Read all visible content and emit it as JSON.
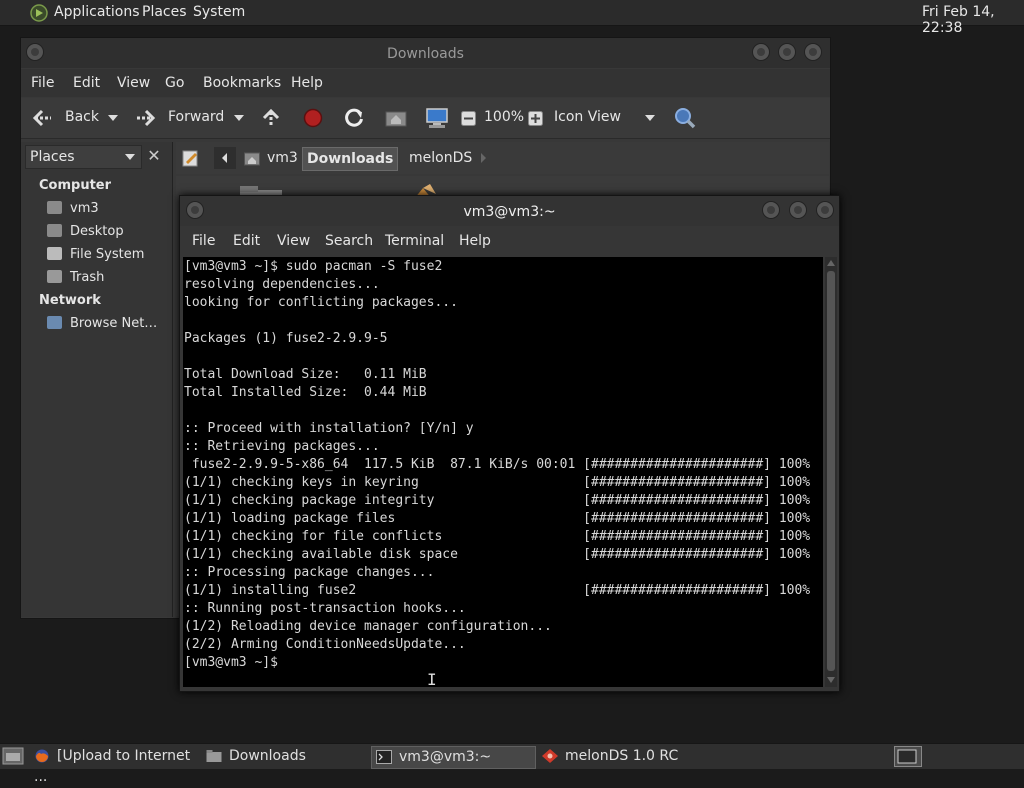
{
  "top_panel": {
    "menus": [
      "Applications",
      "Places",
      "System"
    ],
    "clock": "Fri Feb 14, 22:38"
  },
  "file_manager": {
    "title": "Downloads",
    "menubar": [
      "File",
      "Edit",
      "View",
      "Go",
      "Bookmarks",
      "Help"
    ],
    "toolbar": {
      "back": "Back",
      "forward": "Forward",
      "zoom": "100%",
      "view_mode": "Icon View"
    },
    "sidebar": {
      "selector": "Places",
      "sections": [
        {
          "heading": "Computer",
          "items": [
            "vm3",
            "Desktop",
            "File System",
            "Trash"
          ]
        },
        {
          "heading": "Network",
          "items": [
            "Browse Net…"
          ]
        }
      ]
    },
    "path": [
      "vm3",
      "Downloads",
      "melonDS"
    ]
  },
  "terminal": {
    "title": "vm3@vm3:~",
    "menubar": [
      "File",
      "Edit",
      "View",
      "Search",
      "Terminal",
      "Help"
    ],
    "lines": [
      "[vm3@vm3 ~]$ sudo pacman -S fuse2",
      "resolving dependencies...",
      "looking for conflicting packages...",
      "",
      "Packages (1) fuse2-2.9.9-5",
      "",
      "Total Download Size:   0.11 MiB",
      "Total Installed Size:  0.44 MiB",
      "",
      ":: Proceed with installation? [Y/n] y",
      ":: Retrieving packages...",
      " fuse2-2.9.9-5-x86_64  117.5 KiB  87.1 KiB/s 00:01 [######################] 100%",
      "(1/1) checking keys in keyring                     [######################] 100%",
      "(1/1) checking package integrity                   [######################] 100%",
      "(1/1) loading package files                        [######################] 100%",
      "(1/1) checking for file conflicts                  [######################] 100%",
      "(1/1) checking available disk space                [######################] 100%",
      ":: Processing package changes...",
      "(1/1) installing fuse2                             [######################] 100%",
      ":: Running post-transaction hooks...",
      "(1/2) Reloading device manager configuration...",
      "(2/2) Arming ConditionNeedsUpdate...",
      "[vm3@vm3 ~]$"
    ]
  },
  "taskbar": {
    "tasks": [
      "[Upload to Internet ...",
      "Downloads",
      "vm3@vm3:~",
      "melonDS 1.0 RC"
    ]
  }
}
